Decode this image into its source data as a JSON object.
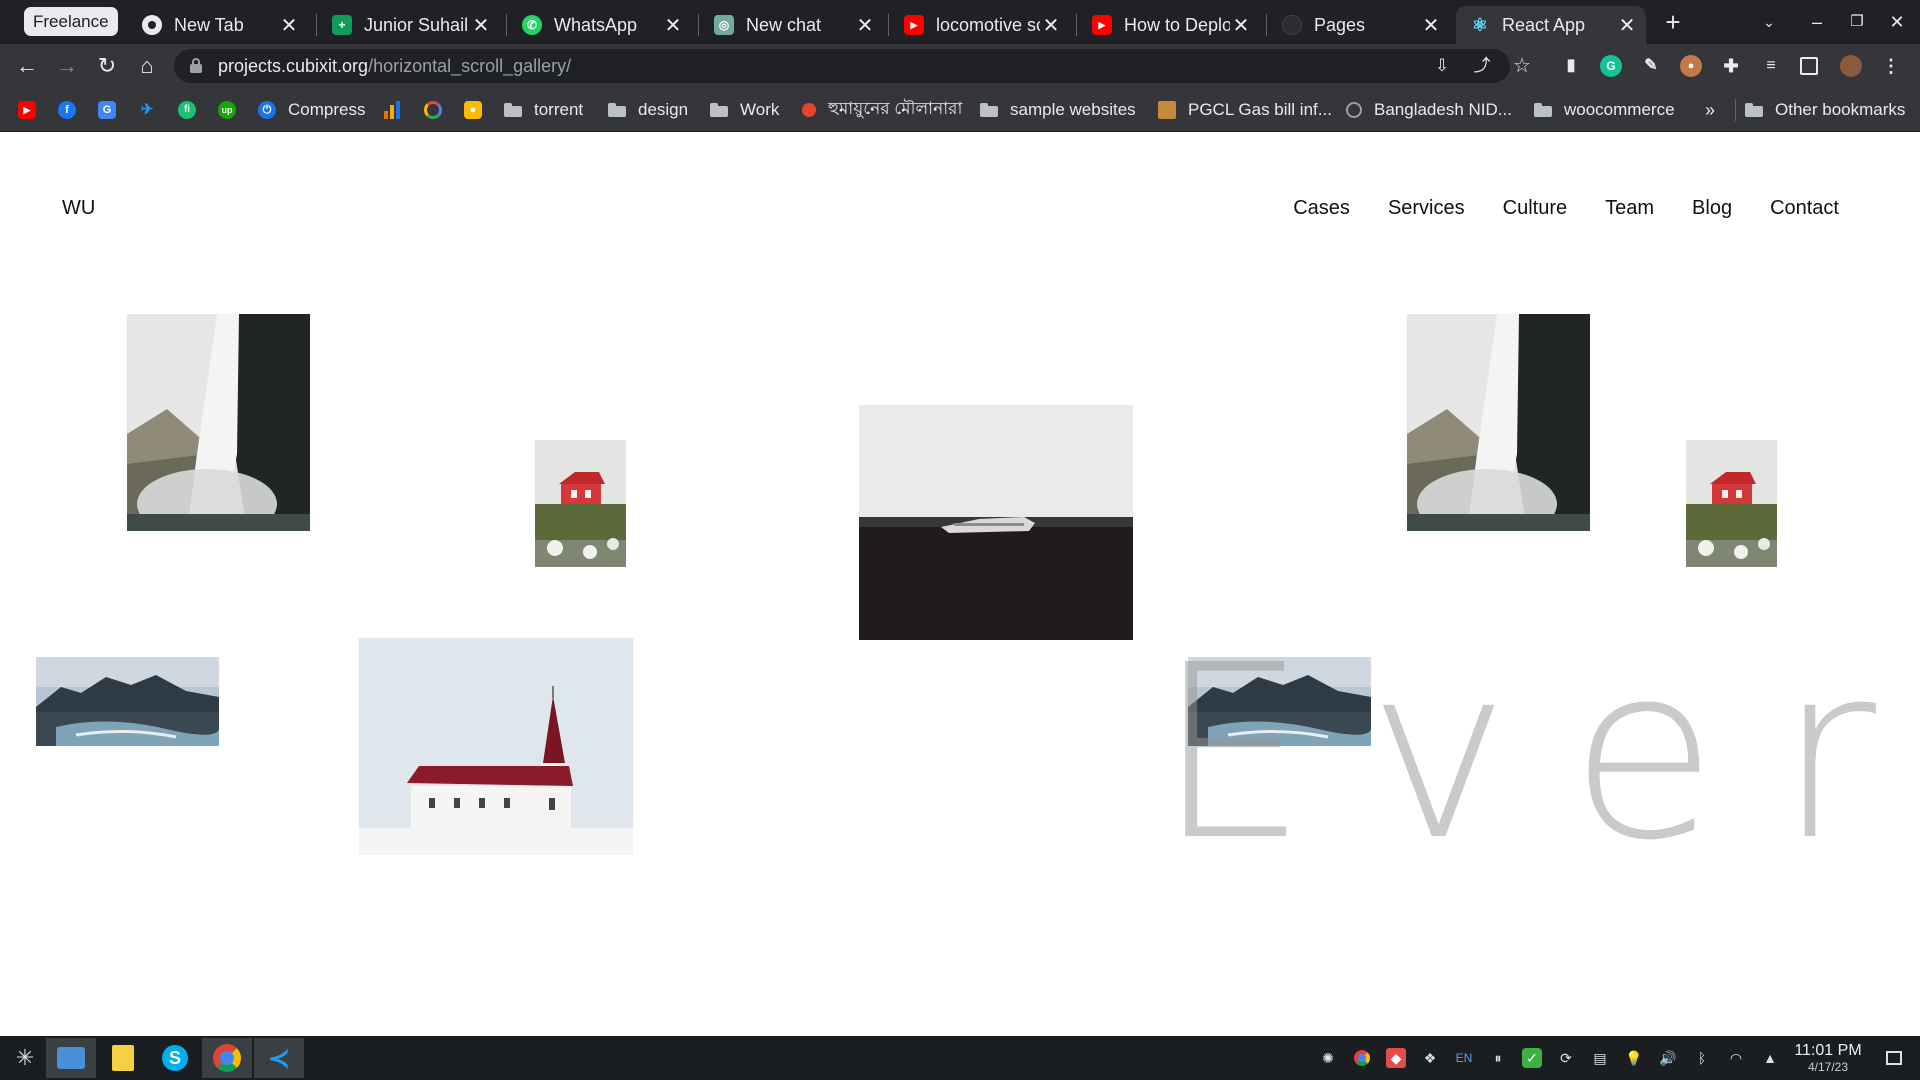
{
  "browser": {
    "tab_group_label": "Freelance",
    "tabs": [
      {
        "title": "New Tab",
        "icon": "chrome-icon",
        "color": "#e8eaed"
      },
      {
        "title": "Junior Suhail -",
        "icon": "sheets-icon",
        "color": "#0f9d58"
      },
      {
        "title": "WhatsApp",
        "icon": "whatsapp-icon",
        "color": "#25d366"
      },
      {
        "title": "New chat",
        "icon": "chatgpt-icon",
        "color": "#74aa9c"
      },
      {
        "title": "locomotive sc",
        "icon": "youtube-icon",
        "color": "#ff0000"
      },
      {
        "title": "How to Deplo",
        "icon": "youtube-icon",
        "color": "#ff0000"
      },
      {
        "title": "Pages",
        "icon": "github-icon",
        "color": "#24292e"
      },
      {
        "title": "React App",
        "icon": "react-icon",
        "color": "#61dafb"
      }
    ],
    "active_tab_index": 7,
    "url_host": "projects.cubixit.org",
    "url_path": "/horizontal_scroll_gallery/"
  },
  "bookmarks": {
    "icon_only": [
      {
        "icon": "youtube-icon",
        "color": "#ff0000",
        "glyph": "▶"
      },
      {
        "icon": "facebook-icon",
        "color": "#1877f2",
        "glyph": "f"
      },
      {
        "icon": "translate-icon",
        "color": "#4285f4",
        "glyph": "G"
      },
      {
        "icon": "bird-icon",
        "color": "#1d9bf0",
        "glyph": "✈"
      },
      {
        "icon": "fiverr-icon",
        "color": "#1dbf73",
        "glyph": "fi"
      },
      {
        "icon": "upwork-icon",
        "color": "#14a800",
        "glyph": "up"
      }
    ],
    "items": [
      {
        "label": "Compress",
        "icon": "compress-icon",
        "color": "#1a73e8"
      },
      {
        "label": "",
        "icon": "analytics-icon",
        "color": "#f4b400"
      },
      {
        "label": "",
        "icon": "ring-icon",
        "color": "#ea4335"
      },
      {
        "label": "",
        "icon": "keep-icon",
        "color": "#fbbc04"
      },
      {
        "label": "torrent",
        "icon": "folder-icon"
      },
      {
        "label": "design",
        "icon": "folder-icon"
      },
      {
        "label": "Work",
        "icon": "folder-icon"
      },
      {
        "label": "হুমায়ুনের মৌলানারা",
        "icon": "red-dot-icon",
        "color": "#e8442c"
      },
      {
        "label": "sample websites",
        "icon": "folder-icon"
      },
      {
        "label": "PGCL Gas bill inf...",
        "icon": "pgcl-icon",
        "color": "#c28a3a"
      },
      {
        "label": "Bangladesh NID...",
        "icon": "globe-icon",
        "color": "#9aa0a6"
      },
      {
        "label": "woocommerce",
        "icon": "folder-icon"
      }
    ],
    "overflow": "»",
    "other_bookmarks": "Other bookmarks"
  },
  "page": {
    "logo": "WU",
    "nav": [
      "Cases",
      "Services",
      "Culture",
      "Team",
      "Blog",
      "Contact"
    ],
    "big_word": "Every",
    "images": [
      {
        "name": "waterfall-photo",
        "subject": "waterfall"
      },
      {
        "name": "red-hut-photo",
        "subject": "red hut"
      },
      {
        "name": "plane-wreck-photo",
        "subject": "plane wreck"
      },
      {
        "name": "waterfall-photo-2",
        "subject": "waterfall"
      },
      {
        "name": "red-hut-photo-2",
        "subject": "red hut"
      },
      {
        "name": "mountain-coast-photo",
        "subject": "mountain coast"
      },
      {
        "name": "church-photo",
        "subject": "church"
      },
      {
        "name": "mountain-coast-photo-2",
        "subject": "mountain coast"
      }
    ]
  },
  "taskbar": {
    "apps": [
      {
        "name": "file-manager-icon",
        "color": "#4a90d9"
      },
      {
        "name": "notes-icon",
        "color": "#f5d142"
      },
      {
        "name": "skype-icon",
        "color": "#00aff0"
      },
      {
        "name": "chrome-icon",
        "color": "#db4437"
      },
      {
        "name": "vscode-icon",
        "color": "#1f9cf0"
      }
    ],
    "language": "EN",
    "time": "11:01 PM",
    "date": "4/17/23"
  }
}
